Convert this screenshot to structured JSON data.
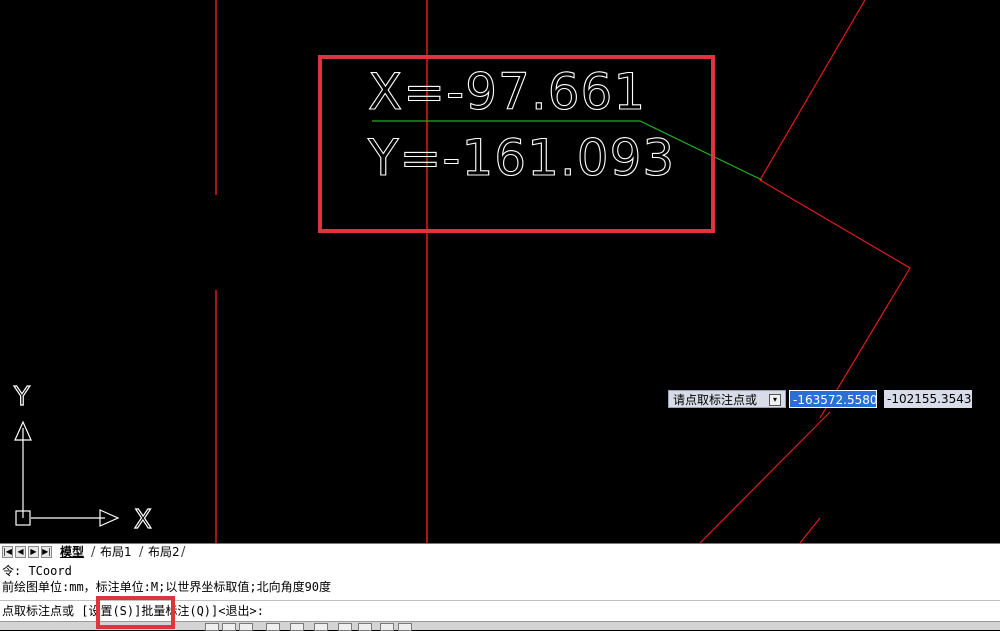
{
  "canvas": {
    "coord_x_text": "X=-97.661",
    "coord_y_text": "Y=-161.093",
    "ucs_y_label": "Y",
    "ucs_x_label": "X"
  },
  "dynamic_input": {
    "prompt": "请点取标注点或",
    "arrow": "▾",
    "x_value": "-163572.5580",
    "y_value": "-102155.3543"
  },
  "layout_tabs": {
    "nav_first": "|◀",
    "nav_prev": "◀",
    "nav_next": "▶",
    "nav_last": "▶|",
    "tabs": [
      "模型",
      "布局1",
      "布局2"
    ]
  },
  "command_window": {
    "line1": "令: TCoord",
    "line2": "前绘图单位:mm，标注单位:M;以世界坐标取值;北向角度90度",
    "line3": "点取标注点或 [设置(S)]批量标注(Q)]<退出>:"
  },
  "colors": {
    "background": "#000000",
    "red_lines": "#e01a1a",
    "green_leader": "#22b022",
    "annotation_red": "#e0333b",
    "input_highlight": "#2a6fd6"
  }
}
